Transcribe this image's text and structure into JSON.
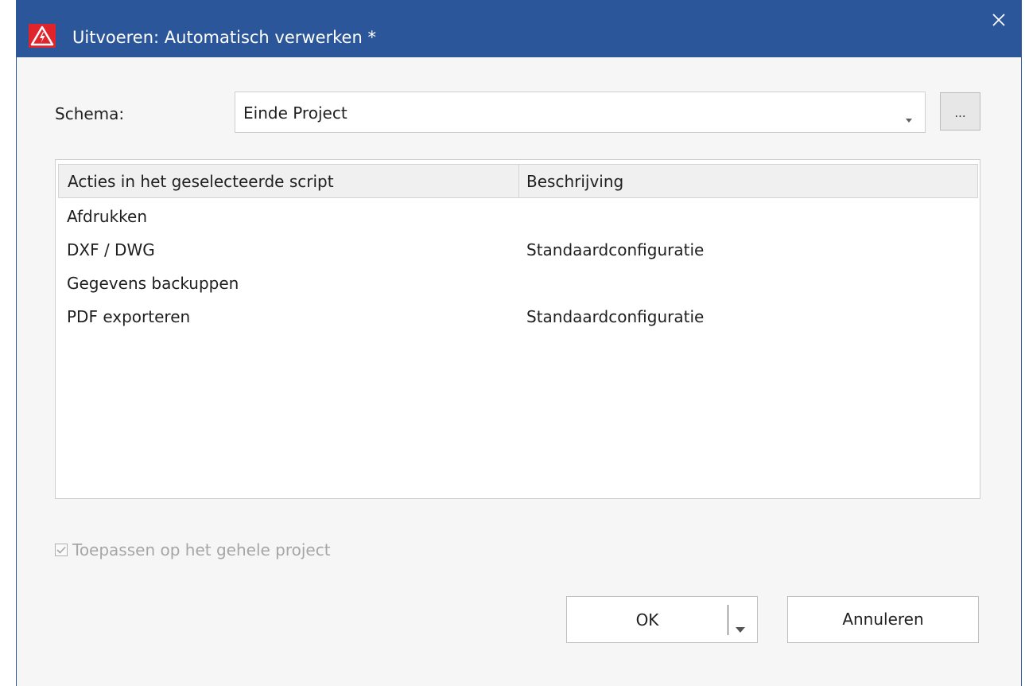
{
  "window": {
    "title": "Uitvoeren: Automatisch verwerken *",
    "accent": "#2b579a",
    "icon": "warning-triangle-icon",
    "close_icon": "close-icon"
  },
  "schema": {
    "label": "Schema:",
    "selected": "Einde Project",
    "browse_label": "..."
  },
  "table": {
    "headers": [
      "Acties in het geselecteerde script",
      "Beschrijving"
    ],
    "rows": [
      {
        "action": "Afdrukken",
        "description": ""
      },
      {
        "action": "DXF / DWG",
        "description": "Standaardconfiguratie"
      },
      {
        "action": "Gegevens backuppen",
        "description": ""
      },
      {
        "action": "PDF exporteren",
        "description": "Standaardconfiguratie"
      }
    ]
  },
  "apply_checkbox": {
    "label": "Toepassen op het gehele project",
    "checked": true,
    "disabled": true
  },
  "buttons": {
    "ok_label": "OK",
    "cancel_label": "Annuleren"
  }
}
